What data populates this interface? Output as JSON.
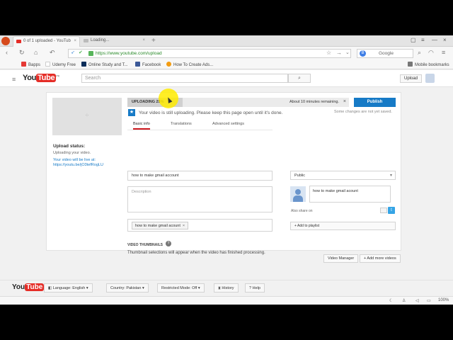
{
  "browser": {
    "tabs": [
      {
        "label": "0 of 1 uploaded - YouTub"
      },
      {
        "label": "Loading..."
      }
    ],
    "url": "https://www.youtube.com/upload",
    "search_engine": "Google",
    "search_engine_badge": "B",
    "bookmarks": [
      {
        "label": "Bapps",
        "color": "#e53935"
      },
      {
        "label": "Udemy Free",
        "color": "#ffffff"
      },
      {
        "label": "Online Study and T...",
        "color": "#0b2e5a"
      },
      {
        "label": "Facebook",
        "color": "#3b5998"
      },
      {
        "label": "How To Create Ads...",
        "color": "#f39c12"
      }
    ],
    "mobile_bookmarks": "Mobile bookmarks",
    "status_zoom": "100%"
  },
  "youtube": {
    "logo_you": "You",
    "logo_tube": "Tube",
    "logo_region": "PK",
    "search_placeholder": "Search",
    "upload_label": "Upload"
  },
  "upload": {
    "status_title": "Upload status:",
    "status_sub": "Uploading your video.",
    "live_label": "Your video will be live at:",
    "live_link": "https://youtu.be/jO3tefRogLU",
    "progress_text": "UPLOADING 25%",
    "progress_fraction": 0.25,
    "remaining": "About 10 minutes remaining.",
    "publish_label": "Publish",
    "unsaved": "Some changes are not yet saved.",
    "notice": "Your video is still uploading. Please keep this page open until it's done.",
    "tabs": [
      "Basic info",
      "Translations",
      "Advanced settings"
    ],
    "title_value": "how to make gmail account",
    "description_placeholder": "Description",
    "tag": "how to make gmail acount",
    "privacy": "Public",
    "share_text": "how to make gmail acount",
    "also_share": "Also share on",
    "add_playlist": "+ Add to playlist",
    "thumbnails_title": "VIDEO THUMBNAILS",
    "thumbnails_msg": "Thumbnail selections will appear when the video has finished processing."
  },
  "actions": {
    "video_manager": "Video Manager",
    "add_more": "+ Add more videos"
  },
  "footer": {
    "language": "Language: English",
    "country": "Country: Pakistan",
    "restricted": "Restricted Mode: Off",
    "history": "History",
    "help": "Help"
  }
}
